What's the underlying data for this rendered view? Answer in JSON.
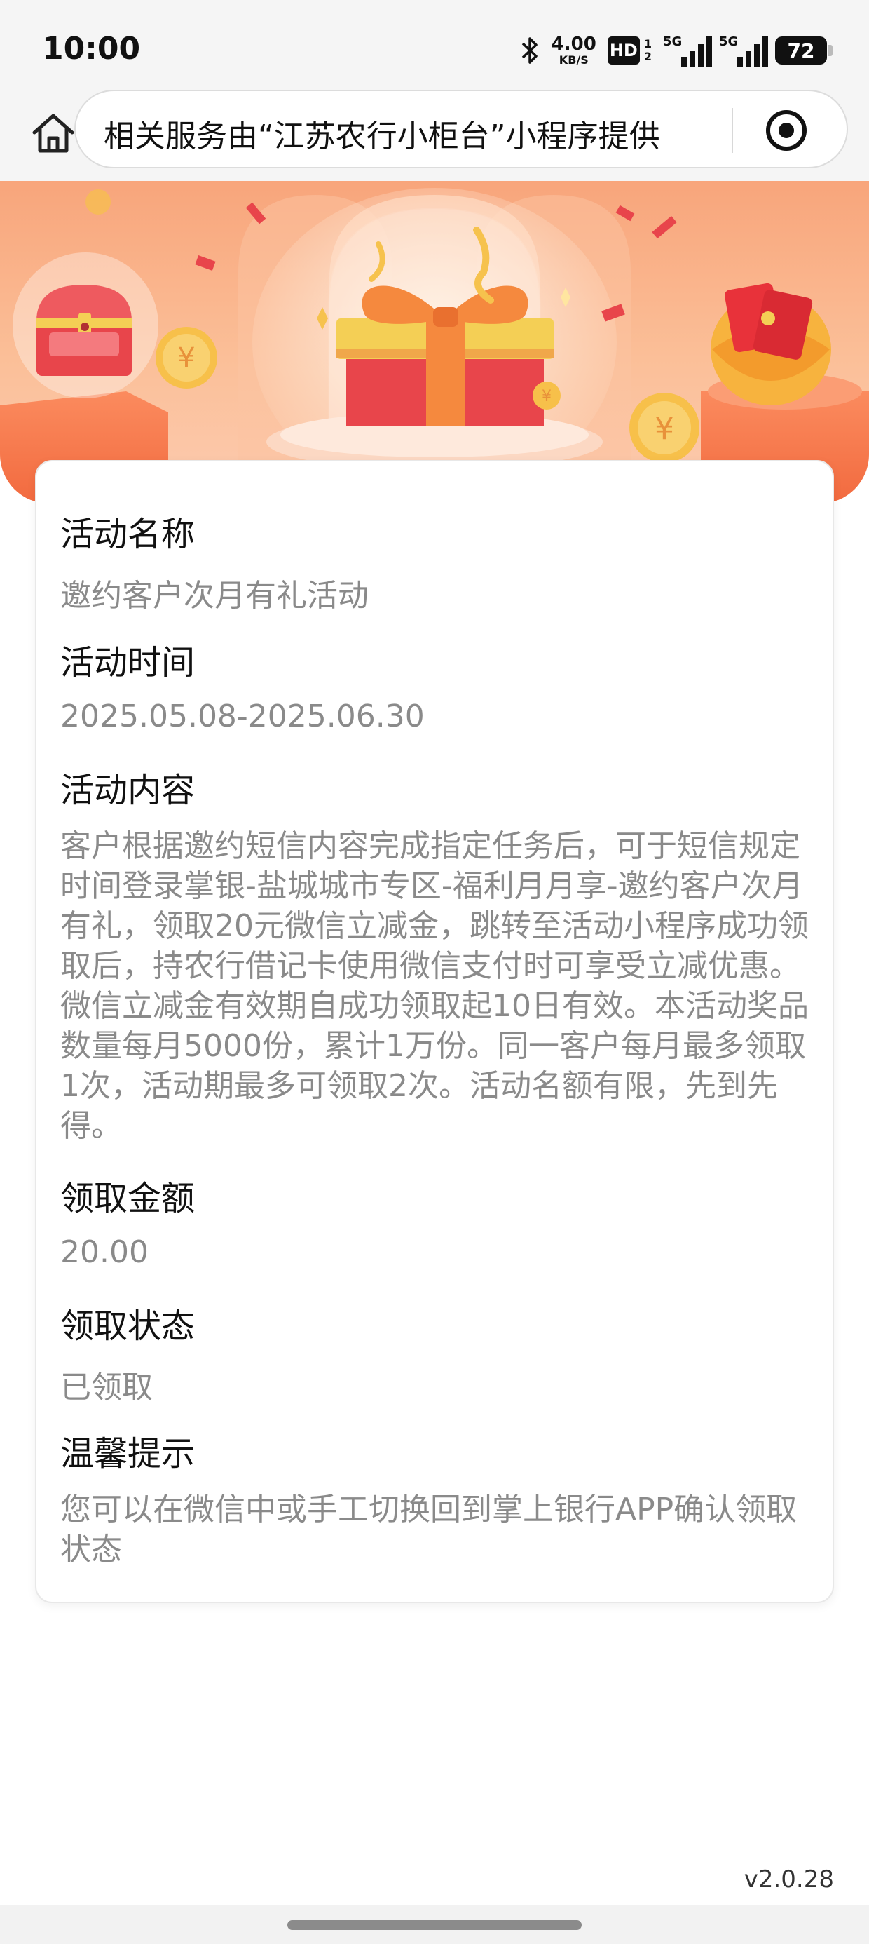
{
  "status_bar": {
    "time": "10:00",
    "net_speed_value": "4.00",
    "net_speed_unit": "KB/S",
    "hd_label": "HD",
    "hd_sub_top": "1",
    "hd_sub_bottom": "2",
    "signal1_label": "5G",
    "signal2_label": "5G",
    "battery": "72"
  },
  "nav": {
    "address_text": "相关服务由“江苏农行小柜台”小程序提供"
  },
  "activity": {
    "name_label": "活动名称",
    "name_value": "邀约客户次月有礼活动",
    "time_label": "活动时间",
    "time_value": "2025.05.08-2025.06.30",
    "content_label": "活动内容",
    "content_value": "客户根据邀约短信内容完成指定任务后，可于短信规定时间登录掌银-盐城城市专区-福利月月享-邀约客户次月有礼，领取20元微信立减金，跳转至活动小程序成功领取后，持农行借记卡使用微信支付时可享受立减优惠。微信立减金有效期自成功领取起10日有效。本活动奖品数量每月5000份，累计1万份。同一客户每月最多领取1次，活动期最多可领取2次。活动名额有限，先到先得。",
    "amount_label": "领取金额",
    "amount_value": "20.00",
    "status_label": "领取状态",
    "status_value": "已领取",
    "tip_label": "温馨提示",
    "tip_value": "您可以在微信中或手工切换回到掌上银行APP确认领取状态"
  },
  "footer": {
    "version": "v2.0.28"
  },
  "colors": {
    "banner_top": "#f8a57b",
    "gift_red": "#e8454b",
    "gift_ribbon": "#f5893e",
    "gold": "#f7c04a",
    "muted_text": "#8a8a8a"
  },
  "icons": [
    "bluetooth-icon",
    "hd-icon",
    "signal-icon",
    "battery-icon",
    "home-icon",
    "target-icon",
    "treasure-chest-icon",
    "gift-box-icon",
    "red-envelope-icon",
    "coin-icon"
  ]
}
